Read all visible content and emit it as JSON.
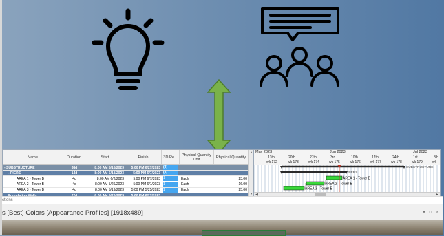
{
  "icons": {
    "lightbulb": "lightbulb-icon",
    "meeting": "people-speech-icon",
    "arrow": "double-arrow-icon",
    "arrow_color": "#7ab24a"
  },
  "grid": {
    "columns": [
      "Name",
      "Duration",
      "Start",
      "Finish",
      "3D Re...",
      "Physical Quantity Unit",
      "Physical Quantity"
    ],
    "rows": [
      {
        "name": "- SUBSTRUCTURE",
        "duration": "38d",
        "start": "8:00 AM 5/18/2023",
        "finish": "5:00 PM 6/27/2023",
        "threed": "(3)",
        "unit": "",
        "qty": "",
        "kind": "summary"
      },
      {
        "name": "- PIERS",
        "duration": "14d",
        "start": "8:00 AM 5/18/2023",
        "finish": "5:00 PM 6/7/2023",
        "threed": "(3)",
        "unit": "",
        "qty": "",
        "kind": "sub"
      },
      {
        "name": "AREA 1 - Tower B",
        "duration": "4d",
        "start": "8:00 AM 6/2/2023",
        "finish": "5:00 PM 6/7/2023",
        "threed": "1",
        "unit": "Each",
        "qty": "23.00",
        "kind": "task"
      },
      {
        "name": "AREA 2 - Tower B",
        "duration": "4d",
        "start": "8:00 AM 5/26/2023",
        "finish": "5:00 PM 6/1/2023",
        "threed": "1",
        "unit": "Each",
        "qty": "16.00",
        "kind": "task"
      },
      {
        "name": "AREA 3 - Tower B",
        "duration": "4d",
        "start": "8:00 AM 5/19/2023",
        "finish": "5:00 PM 5/25/2023",
        "threed": "1",
        "unit": "Each",
        "qty": "25.00",
        "kind": "task"
      },
      {
        "name": "Foundation Walls",
        "duration": "22d",
        "start": "8:00 AM 5/26/2023",
        "finish": "5:00 PM 6/27/2023",
        "threed": "",
        "unit": "",
        "qty": "",
        "kind": "found"
      }
    ]
  },
  "gantt": {
    "months": [
      "May 2023",
      "Jun 2023",
      "Jul 2023"
    ],
    "days": [
      "13th",
      "20th",
      "27th",
      "3rd",
      "10th",
      "17th",
      "24th",
      "1st",
      "8th"
    ],
    "weeks": [
      "wk 172",
      "wk 173",
      "wk 174",
      "wk 175",
      "wk 176",
      "wk 177",
      "wk 178",
      "wk 179",
      "wk"
    ],
    "bar_labels": [
      "SUBSTRUCTURE",
      "PIERS",
      "AREA 1 - Tower B",
      "AREA 2 - Tower B",
      "AREA 3 - Tower B"
    ],
    "bar_color": "#39d83a",
    "summary_color": "#2a2a2a"
  },
  "status_text": "ctions",
  "profiles_title": "s [Best] Colors [Appearance Profiles]  [1918x489]",
  "profiles_buttons": "▾ ⊓ ×"
}
